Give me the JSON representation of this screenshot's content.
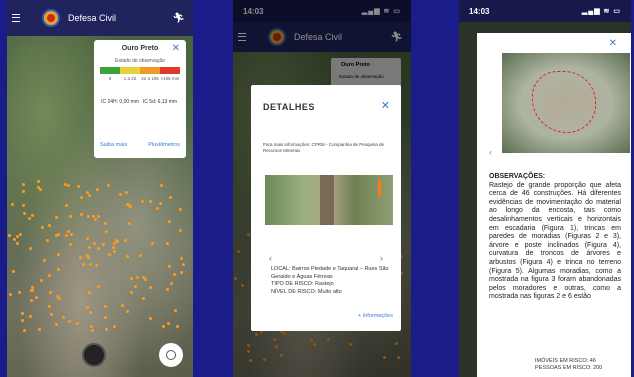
{
  "app": {
    "title": "Defesa Civil"
  },
  "panel1": {
    "legend": {
      "title": "Ouro Preto",
      "subtitle": "Estado de observação",
      "ticks": [
        "0",
        "1 a 22",
        "22 a 106",
        ">106 mm"
      ],
      "ic_left": "IC 24H: 0,00 mm",
      "ic_right": "IC 5d: 6,13 mm",
      "link_left": "Saiba mais",
      "link_right": "Pluviômetros"
    }
  },
  "panel2": {
    "status_time": "14:03",
    "minicard_title": "Ouro Preto",
    "minicard_sub": "Estado de observação",
    "details": {
      "title": "DETALHES",
      "source": "Para mais informações: CPRM - Companhia de Pesquisa de Recursos Minerais",
      "local": "LOCAL: Bairros Piedade e Taquaral – Rues São Geraldo e Águas Férreas",
      "tipo": "TIPO DE RISCO: Rastejo",
      "nivel": "NÍVEL DE RISCO: Muito alto",
      "more": "+ Informações"
    }
  },
  "panel3": {
    "status_time": "14:03",
    "obs_title": "OBSERVAÇÕES:",
    "obs_text": "Rastejo de grande proporção que afeta cerca de 46 construções. Há diferentes evidências de movimentação do material ao longo da encosta, tais como desalinhamentos verticais e horizontais em escadaria (Figura 1), trincas em paredes de moradias (Figuras 2 e 3), árvore e poste inclinados (Figura 4), curvatura de troncos de árvores e arbustos (Figura 4) e trinca no terreno (Figura 5). Algumas moradias, como a mostrada na figura 3 foram abandonadas pelos moradores e outras, como a mostrada nas figuras 2 e 6 estão",
    "imoveis": "IMÓVEIS EM RISCO: 46",
    "pessoas": "PESSOAS EM RISCO: 200"
  },
  "colors": {
    "scale": [
      "#3aa33a",
      "#e8d23a",
      "#f09a28",
      "#e03a2a"
    ],
    "accent": "#3a7bd5"
  }
}
